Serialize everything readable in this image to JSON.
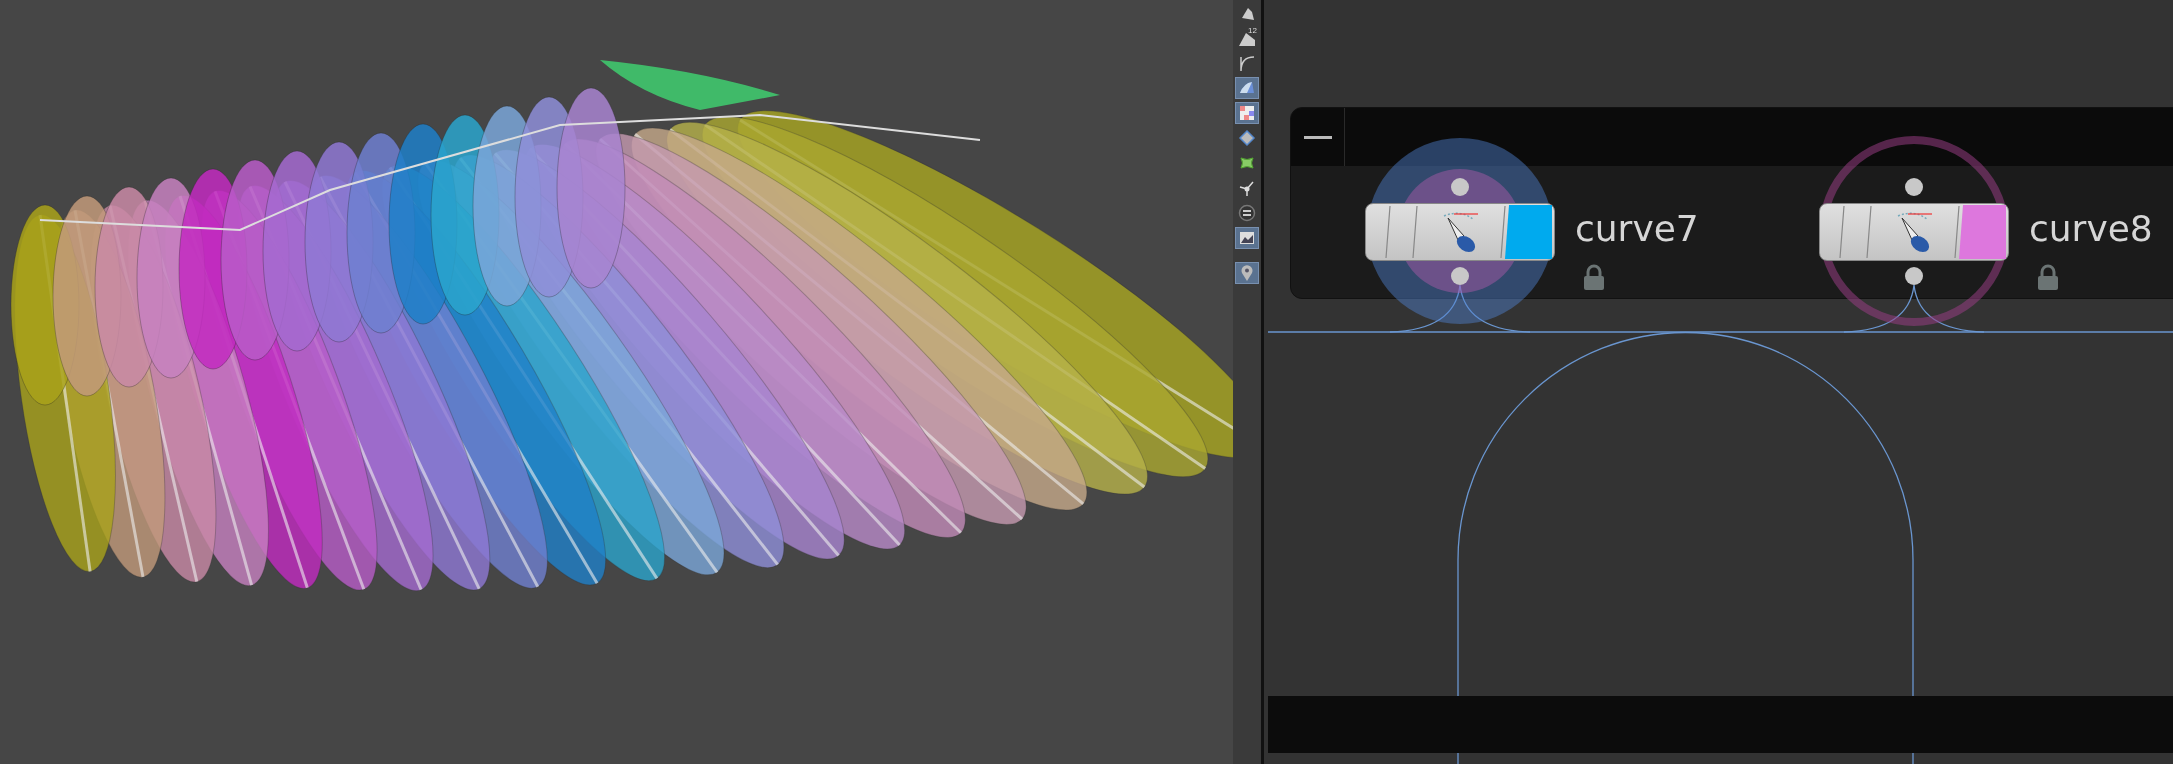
{
  "toolbar": {
    "tools": [
      {
        "kind": "brush",
        "selected": false
      },
      {
        "kind": "number",
        "label": "12",
        "selected": false
      },
      {
        "kind": "curve",
        "selected": false
      },
      {
        "kind": "shade",
        "selected": true
      },
      {
        "kind": "checker",
        "selected": true
      },
      {
        "kind": "diamond",
        "selected": false
      },
      {
        "kind": "uv",
        "selected": false
      },
      {
        "kind": "axes",
        "selected": false
      },
      {
        "kind": "circle",
        "selected": false
      },
      {
        "kind": "image",
        "selected": true
      },
      {
        "kind": "pin",
        "selected": true
      }
    ]
  },
  "network": {
    "nodes": [
      {
        "name": "curve7",
        "color": "#00aaee",
        "selected": true,
        "locked": true
      },
      {
        "name": "curve8",
        "color": "#dd77dd",
        "selected": false,
        "locked": true
      }
    ]
  }
}
